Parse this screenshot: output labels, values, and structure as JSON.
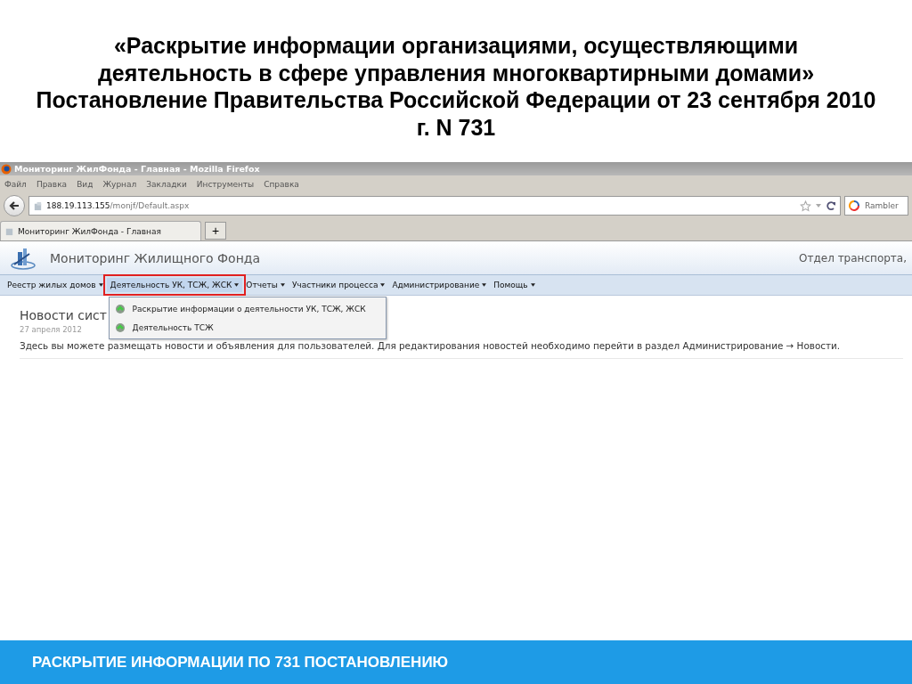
{
  "slide": {
    "title_lines": [
      "«Раскрытие информации организациями, осуществляющими",
      "деятельность в сфере управления многоквартирными домами»",
      "Постановление Правительства Российской Федерации от 23 сентября 2010",
      "г. N 731"
    ],
    "footer": "РАСКРЫТИЕ ИНФОРМАЦИИ ПО 731 ПОСТАНОВЛЕНИЮ"
  },
  "browser": {
    "title": "Мониторинг ЖилФонда - Главная - Mozilla Firefox",
    "menu": [
      "Файл",
      "Правка",
      "Вид",
      "Журнал",
      "Закладки",
      "Инструменты",
      "Справка"
    ],
    "address": {
      "host": "188.19.113.155",
      "path": "/monjf/Default.aspx"
    },
    "search": {
      "placeholder": "Rambler"
    },
    "tabs": [
      {
        "label": "Мониторинг ЖилФонда - Главная",
        "selected": true
      }
    ],
    "new_tab": "+"
  },
  "site": {
    "title": "Мониторинг Жилищного Фонда",
    "user": "Отдел транспорта,",
    "nav": [
      {
        "label": "Реестр жилых домов",
        "selected": false,
        "outlined": false
      },
      {
        "label": "Деятельность УК, ТСЖ, ЖСК",
        "selected": true,
        "outlined": true
      },
      {
        "label": "Отчеты",
        "selected": false,
        "outlined": false
      },
      {
        "label": "Участники процесса",
        "selected": false,
        "outlined": false
      },
      {
        "label": "Администрирование",
        "selected": false,
        "outlined": false
      },
      {
        "label": "Помощь",
        "selected": false,
        "outlined": false
      }
    ],
    "dropdown": [
      "Раскрытие информации о деятельности УК, ТСЖ, ЖСК",
      "Деятельность ТСЖ"
    ],
    "news": {
      "heading": "Новости сист",
      "date": "27 апреля 2012",
      "text": "Здесь вы можете размещать новости и объявления для пользователей. Для редактирования новостей необходимо перейти в раздел Администрирование → Новости."
    }
  }
}
